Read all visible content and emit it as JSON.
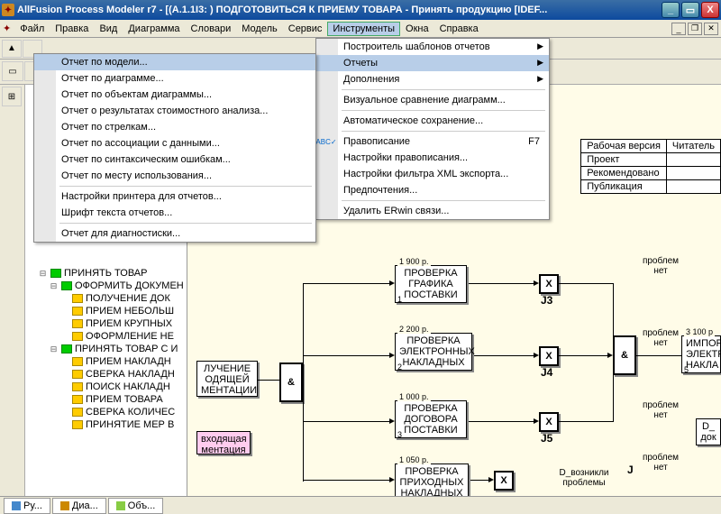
{
  "title": "AllFusion Process Modeler r7 - [(A.1.1I3:   ) ПОДГОТОВИТЬСЯ К ПРИЕМУ ТОВАРА - Принять продукцию  [IDEF...",
  "menu": {
    "file": "Файл",
    "edit": "Правка",
    "view": "Вид",
    "diagram": "Диаграмма",
    "dict": "Словари",
    "model": "Модель",
    "service": "Сервис",
    "tools": "Инструменты",
    "windows": "Окна",
    "help": "Справка"
  },
  "tools_menu": {
    "i1": "Построитель шаблонов отчетов",
    "i2": "Отчеты",
    "i3": "Дополнения",
    "i4": "Визуальное сравнение диаграмм...",
    "i5": "Автоматическое сохранение...",
    "i6": "Правописание",
    "i6k": "F7",
    "i7": "Настройки правописания...",
    "i8": "Настройки фильтра XML экспорта...",
    "i9": "Предпочтения...",
    "i10": "Удалить ERwin связи..."
  },
  "reports_menu": {
    "r1": "Отчет по модели...",
    "r2": "Отчет по диаграмме...",
    "r3": "Отчет по объектам диаграммы...",
    "r4": "Отчет о результатах стоимостного анализа...",
    "r5": "Отчет по стрелкам...",
    "r6": "Отчет по ассоциации с данными...",
    "r7": "Отчет по синтаксическим ошибкам...",
    "r8": "Отчет по месту использования...",
    "r9": "Настройки принтера для отчетов...",
    "r10": "Шрифт текста отчетов...",
    "r11": "Отчет для диагностиски..."
  },
  "tree": {
    "n1": "ПРИНЯТЬ ТОВАР",
    "n2": "ОФОРМИТЬ ДОКУМЕН",
    "n3": "ПОЛУЧЕНИЕ ДОК",
    "n4": "ПРИЕМ НЕБОЛЬШ",
    "n5": "ПРИЕМ КРУПНЫХ",
    "n6": "ОФОРМЛЕНИЕ НЕ",
    "n7": "ПРИНЯТЬ ТОВАР С И",
    "n8": "ПРИЕМ НАКЛАДН",
    "n9": "СВЕРКА НАКЛАДН",
    "n10": "ПОИСК НАКЛАДН",
    "n11": "ПРИЕМ ТОВАРА",
    "n12": "СВЕРКА КОЛИЧЕС",
    "n13": "ПРИНЯТИЕ МЕР В"
  },
  "tabs": {
    "t1": "Ру...",
    "t2": "Диа...",
    "t3": "Объ..."
  },
  "info": {
    "h1": "Рабочая версия",
    "h2": "Читатель",
    "r1": "Проект",
    "r2": "Рекомендовано",
    "r3": "Публикация"
  },
  "diagram": {
    "b1": {
      "cost": "1 900 p.",
      "t": "ПРОВЕРКА ГРАФИКА ПОСТАВКИ",
      "n": "1"
    },
    "b2": {
      "cost": "2 200 p.",
      "t": "ПРОВЕРКА ЭЛЕКТРОННЫХ НАКЛАДНЫХ",
      "n": "2"
    },
    "b3": {
      "cost": "1 000 p.",
      "t": "ПРОВЕРКА ДОГОВОРА ПОСТАВКИ",
      "n": "3"
    },
    "b4": {
      "cost": "1 050 p.",
      "t": "ПРОВЕРКА ПРИХОДНЫХ НАКЛАДНЫХ"
    },
    "b5": {
      "t": "ИМПОРТ ЭЛЕКТР НАКЛА",
      "n": "5"
    },
    "left1": "ЛУЧЕНИЕ ОДЯЩЕЙ МЕНТАЦИИ",
    "left2": "входящая ментация",
    "j3": "J3",
    "j4": "J4",
    "j5": "J5",
    "x": "X",
    "amp": "&",
    "jr": "J",
    "p1": "проблем нет",
    "p2": "проблем нет",
    "p3": "проблем нет",
    "p4": "проблем нет",
    "pd": "D_возникли проблемы",
    "pd2": "D_\nдок"
  }
}
